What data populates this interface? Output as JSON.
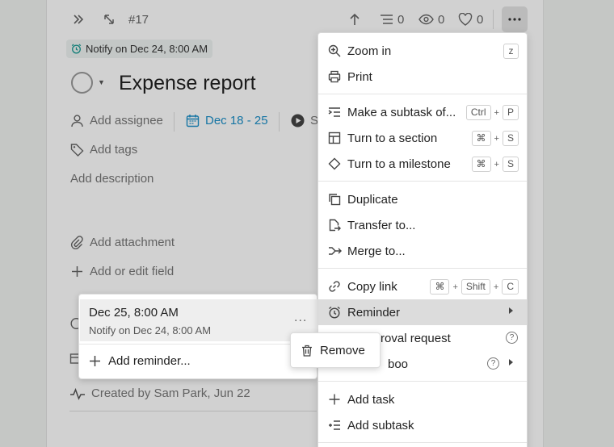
{
  "toolbar": {
    "task_id": "#17",
    "subtasks_count": "0",
    "watchers_count": "0",
    "likes_count": "0"
  },
  "task": {
    "notify_chip": "Notify on Dec 24, 8:00 AM",
    "title": "Expense report",
    "add_assignee": "Add assignee",
    "dates": "Dec 18 - 25",
    "status_partial": "S",
    "add_tags": "Add tags",
    "add_description": "Add description",
    "add_attachment": "Add attachment",
    "add_field": "Add or edit field",
    "created_by": "Created by Sam Park, Jun 22"
  },
  "reminder_popover": {
    "time": "Dec 25, 8:00 AM",
    "notify": "Notify on Dec 24, 8:00 AM",
    "more": "...",
    "add_reminder": "Add reminder..."
  },
  "remove_popover": {
    "label": "Remove"
  },
  "menu": {
    "zoom_in": "Zoom in",
    "zoom_key": "z",
    "print": "Print",
    "make_subtask": "Make a subtask of...",
    "make_subtask_keys": [
      "Ctrl",
      "P"
    ],
    "turn_section": "Turn to a section",
    "turn_section_keys": [
      "⌘",
      "S"
    ],
    "turn_milestone": "Turn to a milestone",
    "turn_milestone_keys": [
      "⌘",
      "S"
    ],
    "duplicate": "Duplicate",
    "transfer": "Transfer to...",
    "merge": "Merge to...",
    "copy_link": "Copy link",
    "copy_link_keys": [
      "⌘",
      "Shift",
      "C"
    ],
    "reminder": "Reminder",
    "approval_partial": "approval request",
    "boo_partial": "boo",
    "add_task": "Add task",
    "add_subtask": "Add subtask"
  },
  "colors": {
    "accent_teal": "#1a9c94",
    "date_blue": "#1b8fc8",
    "active_item": "#dcdcdc"
  }
}
